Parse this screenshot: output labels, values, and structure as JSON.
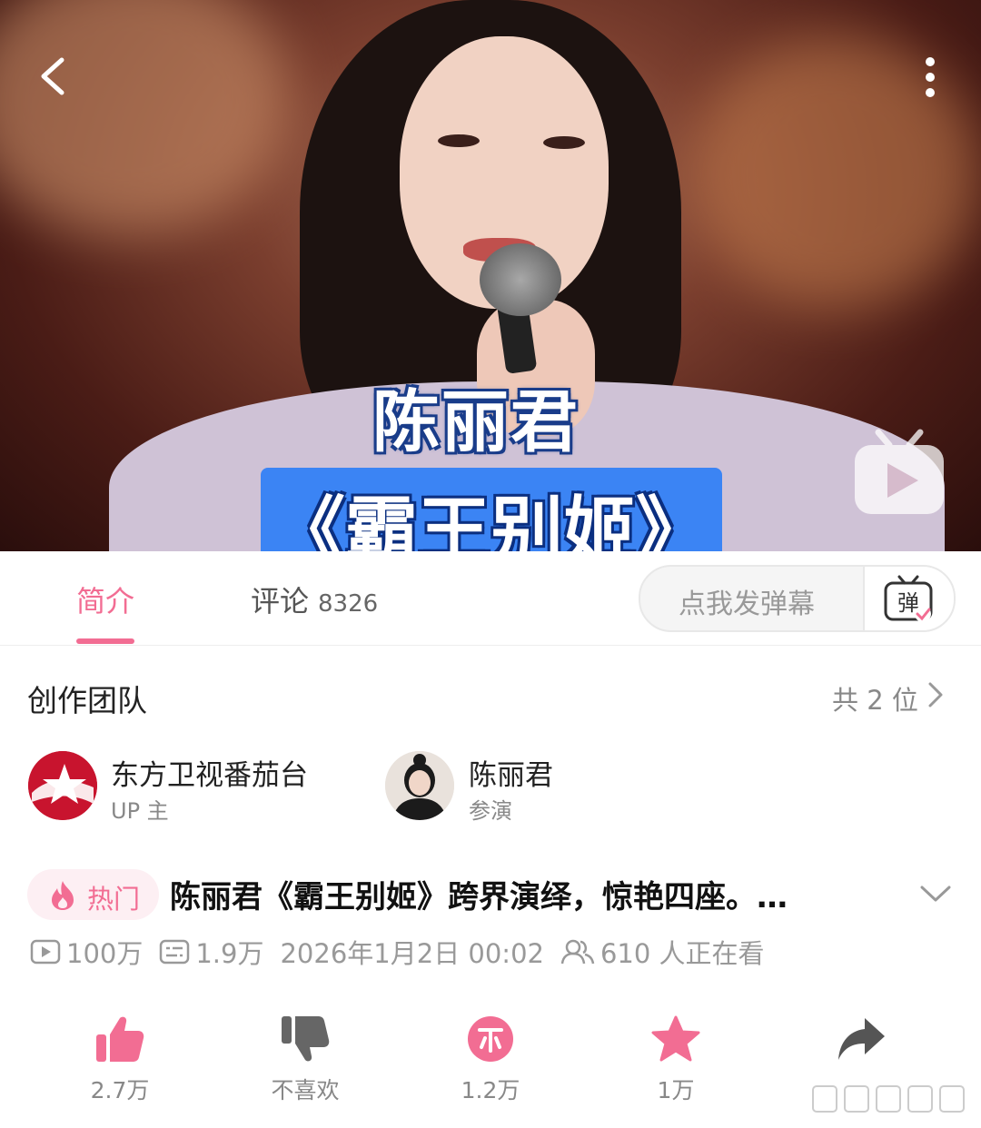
{
  "video": {
    "caption_line1": "陈丽君",
    "caption_line2": "《霸王别姬》"
  },
  "tabs": [
    {
      "label": "简介",
      "count": ""
    },
    {
      "label": "评论",
      "count": "8326"
    }
  ],
  "danmu": {
    "placeholder": "点我发弹幕",
    "icon_char": "弹"
  },
  "team": {
    "title": "创作团队",
    "count_label": "共 2 位",
    "members": [
      {
        "name": "东方卫视番茄台",
        "role": "UP 主"
      },
      {
        "name": "陈丽君",
        "role": "参演"
      }
    ]
  },
  "video_info": {
    "badge": "热门",
    "title": "陈丽君《霸王别姬》跨界演绎，惊艳四座。…",
    "views": "100万",
    "danmaku": "1.9万",
    "datetime": "2026年1月2日 00:02",
    "watching": "610 人正在看"
  },
  "actions": [
    {
      "name": "like",
      "label": "2.7万",
      "color": "#f26d93"
    },
    {
      "name": "dislike",
      "label": "不喜欢",
      "color": "#666666"
    },
    {
      "name": "coin",
      "label": "1.2万",
      "color": "#f26d93"
    },
    {
      "name": "favorite",
      "label": "1万",
      "color": "#f26d93"
    },
    {
      "name": "share",
      "label": "",
      "color": "#555555"
    }
  ],
  "colors": {
    "accent": "#f26d93",
    "caption_blue": "#3b84f4"
  }
}
